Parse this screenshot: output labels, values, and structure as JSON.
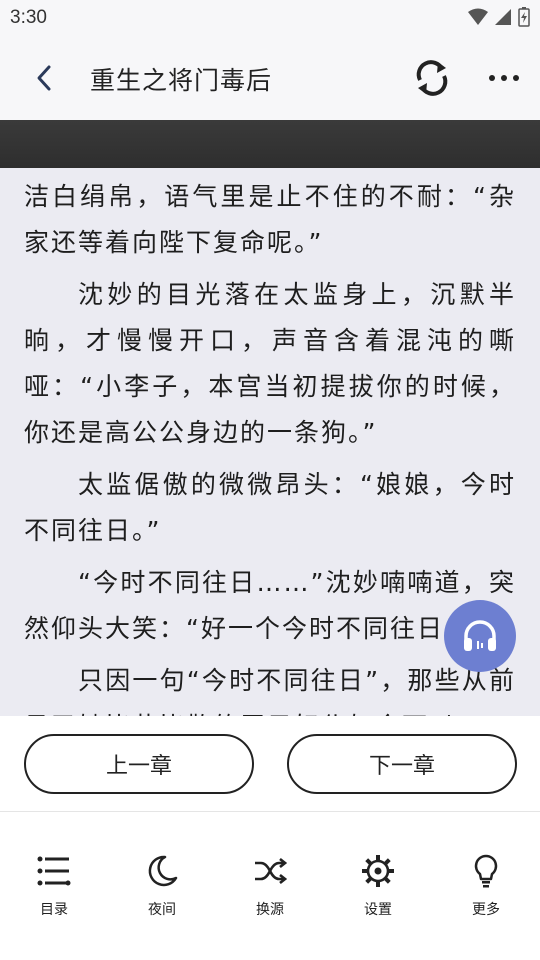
{
  "status": {
    "time": "3:30"
  },
  "header": {
    "title": "重生之将门毒后"
  },
  "reader": {
    "paragraphs": [
      "洁白绢帛，语气里是止不住的不耐：“杂家还等着向陛下复命呢。”",
      "沈妙的目光落在太监身上，沉默半晌，才慢慢开口，声音含着混沌的嘶哑：“小李子，本宫当初提拔你的时候，你还是高公公身边的一条狗。”",
      "太监倨傲的微微昂头：“娘娘，今时不同往日。”",
      "“今时不同往日……”沈妙喃喃道，突然仰头大笑：“好一个今时不同往日！”",
      "只因一句“今时不同往日”，那些从前见了她毕恭毕敬的臣子奴仆如今可以"
    ]
  },
  "chapter_nav": {
    "prev_label": "上一章",
    "next_label": "下一章"
  },
  "toolbar": {
    "items": [
      {
        "label": "目录",
        "icon": "list-icon"
      },
      {
        "label": "夜间",
        "icon": "moon-icon"
      },
      {
        "label": "换源",
        "icon": "shuffle-icon"
      },
      {
        "label": "设置",
        "icon": "gear-icon"
      },
      {
        "label": "更多",
        "icon": "lightbulb-icon"
      }
    ]
  },
  "colors": {
    "reader_bg": "#ebebf2",
    "fab": "#6d7fd1",
    "band": "#333333"
  }
}
